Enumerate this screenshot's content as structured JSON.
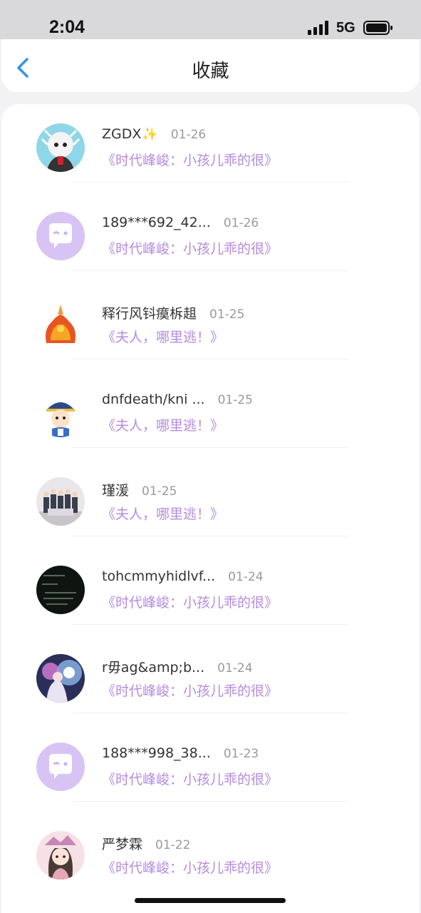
{
  "status_bar": {
    "time": "2:04",
    "network": "5G"
  },
  "nav": {
    "title": "收藏",
    "back_icon": "chevron-left-icon"
  },
  "accent_color": "#b48be0",
  "items": [
    {
      "username": "ZGDX",
      "badge": "✨",
      "date": "01-26",
      "book_title": "《时代峰峻：小孩儿乖的很》"
    },
    {
      "username": "189***692_42...",
      "badge": "",
      "date": "01-26",
      "book_title": "《时代峰峻：小孩儿乖的很》"
    },
    {
      "username": "释行风钭瘼柝趄",
      "badge": "",
      "date": "01-25",
      "book_title": "《夫人，哪里逃！》"
    },
    {
      "username": "dnfdeath/kni ...",
      "badge": "",
      "date": "01-25",
      "book_title": "《夫人，哪里逃！》"
    },
    {
      "username": "瑾湲",
      "badge": "",
      "date": "01-25",
      "book_title": "《夫人，哪里逃！》"
    },
    {
      "username": "tohcmmyhidlvf...",
      "badge": "",
      "date": "01-24",
      "book_title": "《时代峰峻：小孩儿乖的很》"
    },
    {
      "username": "r毋ag&amp;b...",
      "badge": "",
      "date": "01-24",
      "book_title": "《时代峰峻：小孩儿乖的很》"
    },
    {
      "username": "188***998_38...",
      "badge": "",
      "date": "01-23",
      "book_title": "《时代峰峻：小孩儿乖的很》"
    },
    {
      "username": "严梦霖",
      "badge": "",
      "date": "01-22",
      "book_title": "《时代峰峻：小孩儿乖的很》"
    }
  ]
}
